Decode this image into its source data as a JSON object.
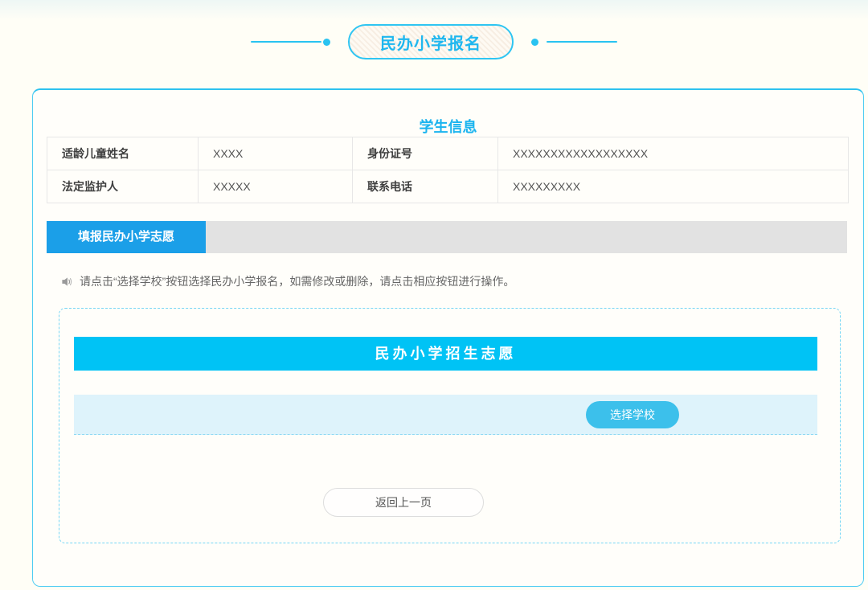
{
  "header": {
    "badge_title": "民办小学报名"
  },
  "student_info": {
    "title": "学生信息",
    "rows": [
      {
        "label1": "适龄儿童姓名",
        "value1": "XXXX",
        "label2": "身份证号",
        "value2": "XXXXXXXXXXXXXXXXXX"
      },
      {
        "label1": "法定监护人",
        "value1": "XXXXX",
        "label2": "联系电话",
        "value2": "XXXXXXXXX"
      }
    ]
  },
  "volunteer_section": {
    "tab_label": "填报民办小学志愿",
    "notice_icon": "speaker-icon",
    "instruction": "请点击“选择学校”按钮选择民办小学报名，如需修改或删除，请点击相应按钮进行操作。",
    "panel_title": "民办小学招生志愿",
    "select_school_button": "选择学校",
    "back_button": "返回上一页"
  },
  "colors": {
    "accent_cyan": "#00c3f5",
    "badge_border": "#2fc5f2",
    "tab_blue": "#1b9fe8",
    "tab_rest_gray": "#e2e2e2",
    "panel_row_bg": "#def3fb",
    "select_button_bg": "#3cc0eb",
    "title_cyan": "#1bb4ef",
    "card_border": "#2ec2ef",
    "page_background": "#fffef6"
  }
}
